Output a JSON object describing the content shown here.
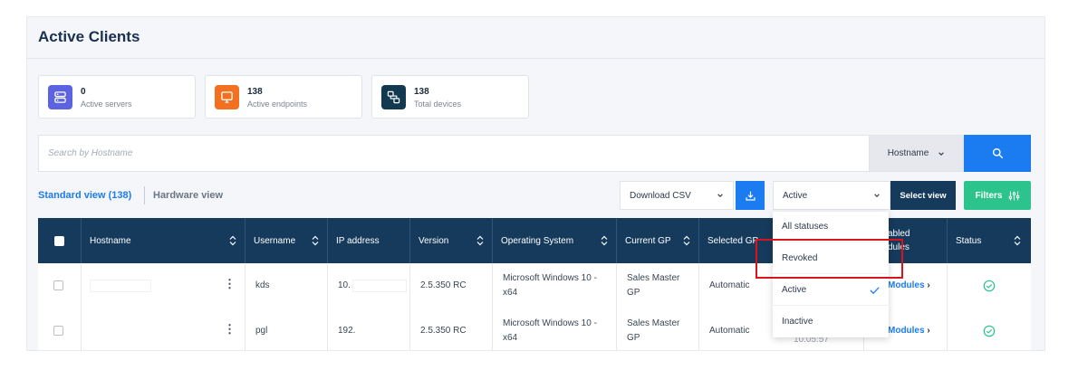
{
  "page": {
    "title": "Active Clients"
  },
  "stats": [
    {
      "value": "0",
      "label": "Active servers",
      "icon": "server-icon",
      "color": "#5c63e0"
    },
    {
      "value": "138",
      "label": "Active endpoints",
      "icon": "monitor-icon",
      "color": "#f37021"
    },
    {
      "value": "138",
      "label": "Total devices",
      "icon": "devices-icon",
      "color": "#12394f"
    }
  ],
  "search": {
    "placeholder": "Search by Hostname",
    "field_select": "Hostname"
  },
  "views": {
    "standard": "Standard view (138)",
    "hardware": "Hardware view"
  },
  "toolbar": {
    "download_csv": "Download CSV",
    "status_select": "Active",
    "select_view": "Select view",
    "filters": "Filters"
  },
  "table": {
    "columns": [
      "Hostname",
      "Username",
      "IP address",
      "Version",
      "Operating System",
      "Current GP",
      "Selected GP",
      "Enabled modules",
      "Status"
    ],
    "column_partial_labels": {
      "selected_gp": "Selected GP",
      "enabled_modules_line1": "abled",
      "enabled_modules_line2": "dules"
    },
    "rows": [
      {
        "hostname": "",
        "username": "kds",
        "ip": "10.",
        "version": "2.5.350 RC",
        "os_line1": "Microsoft Windows 10 -",
        "os_line2": "x64",
        "gp_line1": "Sales Master",
        "gp_line2": "GP",
        "selected_gp": "Automatic",
        "modules": "Modules",
        "status_icon": "check-circle-icon"
      },
      {
        "hostname": "",
        "username": "pgl",
        "ip": "192.",
        "version": "2.5.350 RC",
        "os_line1": "Microsoft Windows 10 -",
        "os_line2": "x64",
        "gp_line1": "Sales Master",
        "gp_line2": "GP",
        "selected_gp": "Automatic",
        "partial_time": "10:05:57",
        "modules": "Modules",
        "status_icon": "check-circle-icon"
      }
    ]
  },
  "status_dropdown": {
    "options": [
      "All statuses",
      "Revoked",
      "Active",
      "Inactive"
    ],
    "selected": "Active"
  },
  "colors": {
    "primary": "#1b7cf2",
    "navy": "#163a5c",
    "green": "#2cc38c",
    "highlight": "#d9141b"
  }
}
